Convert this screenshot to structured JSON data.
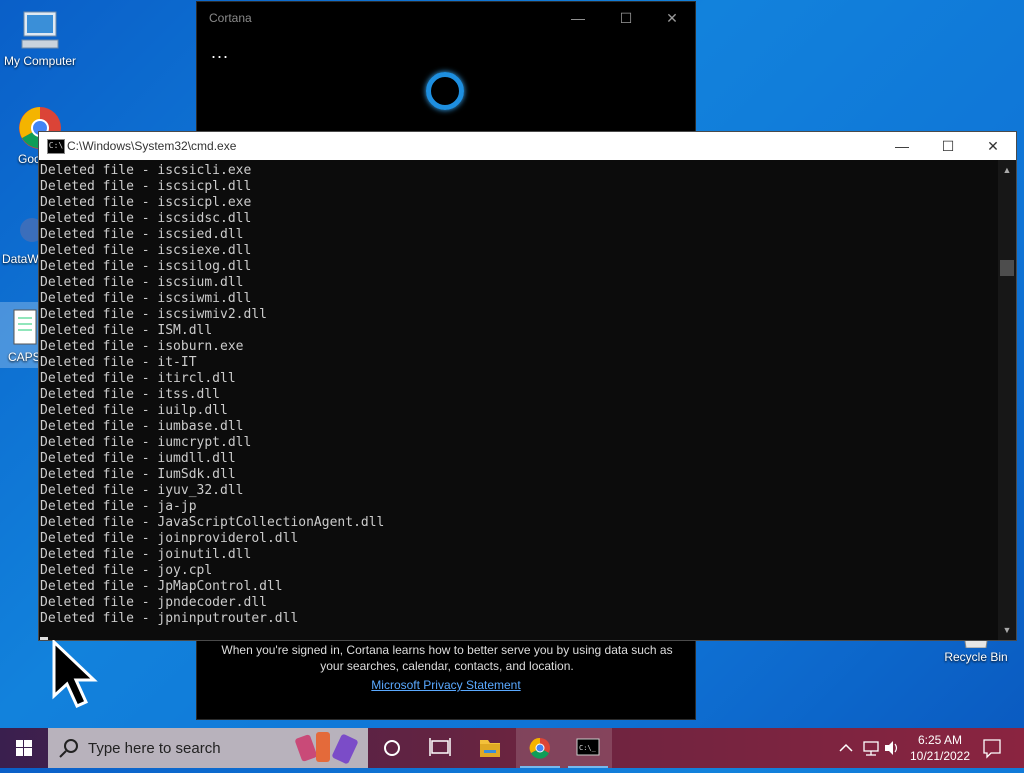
{
  "desktop": {
    "icons": [
      {
        "label": "My Computer"
      },
      {
        "label": "Goo Chro"
      },
      {
        "label": "DataW"
      },
      {
        "label": "CAPS"
      },
      {
        "label": "Recycle Bin"
      }
    ]
  },
  "cortana": {
    "title": "Cortana",
    "dots": "...",
    "info_line1": "When you're signed in, Cortana learns how to better serve you by using data such as",
    "info_line2": "your searches, calendar, contacts, and location.",
    "privacy_link": "Microsoft Privacy Statement"
  },
  "cmd": {
    "title": "C:\\Windows\\System32\\cmd.exe",
    "lines": [
      "Deleted file - iscsicli.exe",
      "Deleted file - iscsicpl.dll",
      "Deleted file - iscsicpl.exe",
      "Deleted file - iscsidsc.dll",
      "Deleted file - iscsied.dll",
      "Deleted file - iscsiexe.dll",
      "Deleted file - iscsilog.dll",
      "Deleted file - iscsium.dll",
      "Deleted file - iscsiwmi.dll",
      "Deleted file - iscsiwmiv2.dll",
      "Deleted file - ISM.dll",
      "Deleted file - isoburn.exe",
      "Deleted file - it-IT",
      "Deleted file - itircl.dll",
      "Deleted file - itss.dll",
      "Deleted file - iuilp.dll",
      "Deleted file - iumbase.dll",
      "Deleted file - iumcrypt.dll",
      "Deleted file - iumdll.dll",
      "Deleted file - IumSdk.dll",
      "Deleted file - iyuv_32.dll",
      "Deleted file - ja-jp",
      "Deleted file - JavaScriptCollectionAgent.dll",
      "Deleted file - joinproviderol.dll",
      "Deleted file - joinutil.dll",
      "Deleted file - joy.cpl",
      "Deleted file - JpMapControl.dll",
      "Deleted file - jpndecoder.dll",
      "Deleted file - jpninputrouter.dll"
    ]
  },
  "taskbar": {
    "search_placeholder": "Type here to search",
    "time": "6:25 AM",
    "date": "10/21/2022"
  }
}
